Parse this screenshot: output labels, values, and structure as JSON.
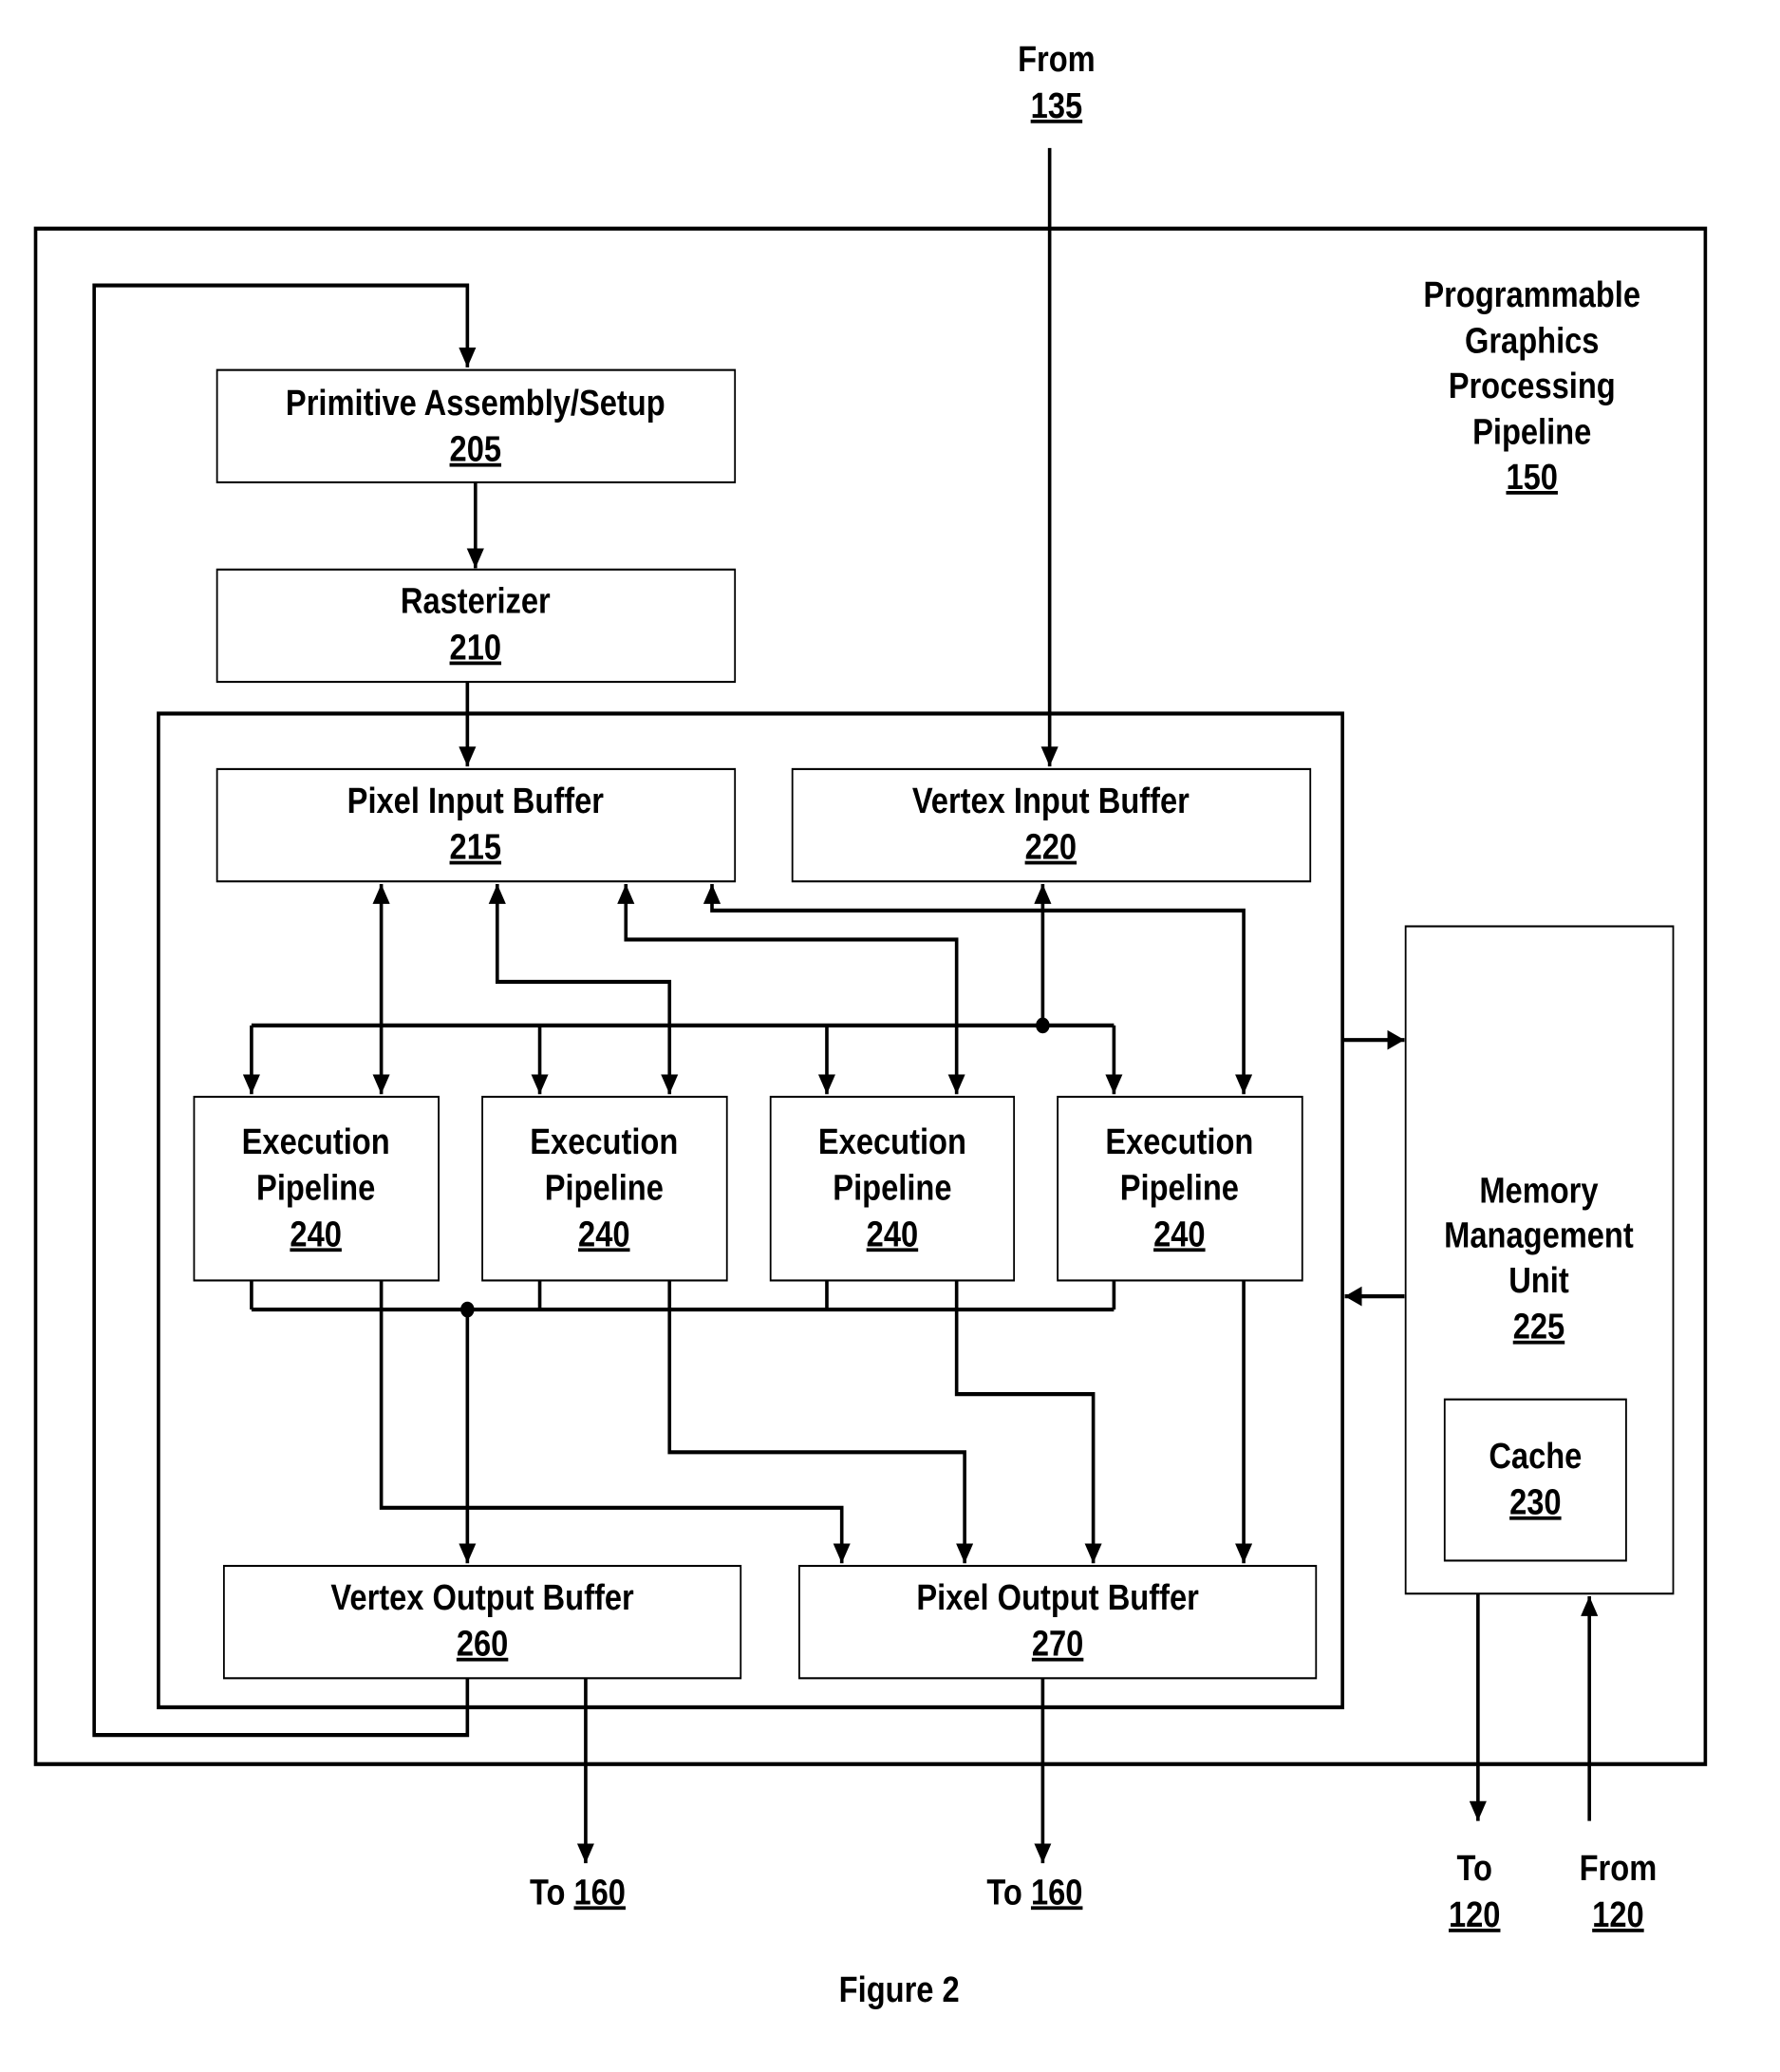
{
  "figure_caption": "Figure 2",
  "container": {
    "title_lines": [
      "Programmable",
      "Graphics",
      "Processing",
      "Pipeline"
    ],
    "ref": "150"
  },
  "blocks": {
    "primitive_assembly": {
      "label": "Primitive Assembly/Setup",
      "ref": "205"
    },
    "rasterizer": {
      "label": "Rasterizer",
      "ref": "210"
    },
    "pixel_input_buffer": {
      "label": "Pixel Input Buffer",
      "ref": "215"
    },
    "vertex_input_buffer": {
      "label": "Vertex Input Buffer",
      "ref": "220"
    },
    "execution_pipelines": [
      {
        "line1": "Execution",
        "line2": "Pipeline",
        "ref": "240"
      },
      {
        "line1": "Execution",
        "line2": "Pipeline",
        "ref": "240"
      },
      {
        "line1": "Execution",
        "line2": "Pipeline",
        "ref": "240"
      },
      {
        "line1": "Execution",
        "line2": "Pipeline",
        "ref": "240"
      }
    ],
    "vertex_output_buffer": {
      "label": "Vertex Output Buffer",
      "ref": "260"
    },
    "pixel_output_buffer": {
      "label": "Pixel Output Buffer",
      "ref": "270"
    },
    "memory_management_unit": {
      "lines": [
        "Memory",
        "Management",
        "Unit"
      ],
      "ref": "225"
    },
    "cache": {
      "label": "Cache",
      "ref": "230"
    }
  },
  "external": {
    "from_135": {
      "word": "From",
      "ref": "135"
    },
    "to_160_a": {
      "word": "To",
      "ref": "160"
    },
    "to_160_b": {
      "word": "To",
      "ref": "160"
    },
    "to_120": {
      "word": "To",
      "ref": "120"
    },
    "from_120": {
      "word": "From",
      "ref": "120"
    }
  }
}
